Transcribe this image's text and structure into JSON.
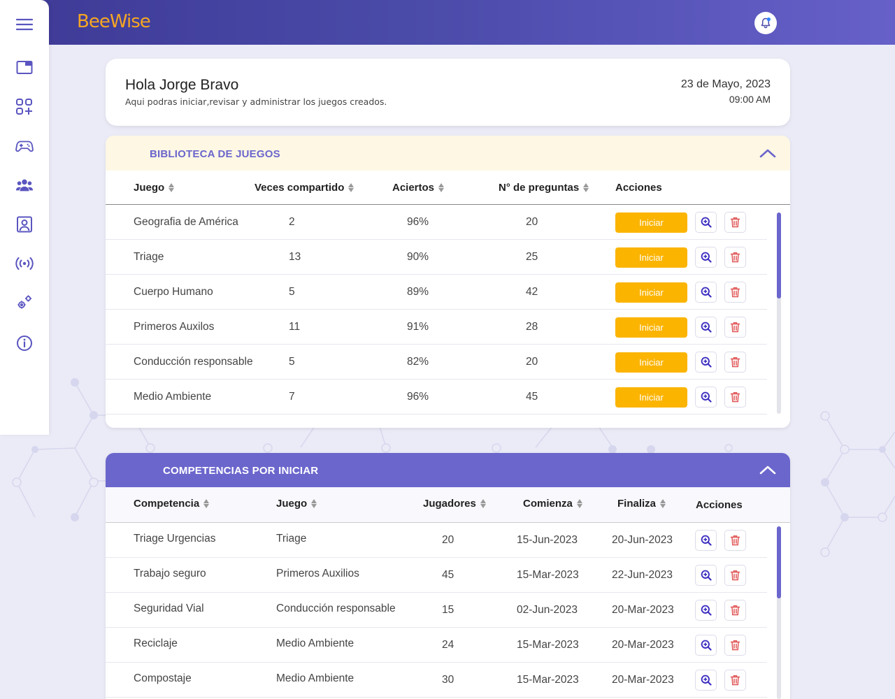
{
  "app": {
    "logo": "BeeWise"
  },
  "sidebar": {
    "items": [
      {
        "name": "menu-icon"
      },
      {
        "name": "window-icon"
      },
      {
        "name": "apps-add-icon"
      },
      {
        "name": "gamepad-icon"
      },
      {
        "name": "users-icon"
      },
      {
        "name": "contact-icon"
      },
      {
        "name": "broadcast-icon"
      },
      {
        "name": "settings-icon"
      },
      {
        "name": "info-icon"
      }
    ]
  },
  "greeting": {
    "title": "Hola Jorge Bravo",
    "subtitle": "Aqui podras iniciar,revisar y administrar los juegos creados.",
    "date": "23 de Mayo, 2023",
    "time": "09:00 AM"
  },
  "library": {
    "title": "BIBLIOTECA DE JUEGOS",
    "columns": [
      "Juego",
      "Veces compartido",
      "Aciertos",
      "N° de preguntas",
      "Acciones"
    ],
    "start_label": "Iniciar",
    "rows": [
      {
        "game": "Geografia de América",
        "shared": "2",
        "hits": "96%",
        "questions": "20"
      },
      {
        "game": "Triage",
        "shared": "13",
        "hits": "90%",
        "questions": "25"
      },
      {
        "game": "Cuerpo Humano",
        "shared": "5",
        "hits": "89%",
        "questions": "42"
      },
      {
        "game": "Primeros Auxilos",
        "shared": "11",
        "hits": "91%",
        "questions": "28"
      },
      {
        "game": "Conducción responsable",
        "shared": "5",
        "hits": "82%",
        "questions": "20"
      },
      {
        "game": "Medio Ambiente",
        "shared": "7",
        "hits": "96%",
        "questions": "45"
      }
    ]
  },
  "competitions": {
    "title": "COMPETENCIAS POR INICIAR",
    "columns": [
      "Competencia",
      "Juego",
      "Jugadores",
      "Comienza",
      "Finaliza",
      "Acciones"
    ],
    "rows": [
      {
        "name": "Triage Urgencias",
        "game": "Triage",
        "players": "20",
        "start": "15-Jun-2023",
        "end": "20-Jun-2023"
      },
      {
        "name": "Trabajo seguro",
        "game": "Primeros Auxilios",
        "players": "45",
        "start": "15-Mar-2023",
        "end": "22-Jun-2023"
      },
      {
        "name": "Seguridad Vial",
        "game": "Conducción responsable",
        "players": "15",
        "start": "02-Jun-2023",
        "end": "20-Mar-2023"
      },
      {
        "name": "Reciclaje",
        "game": "Medio Ambiente",
        "players": "24",
        "start": "15-Mar-2023",
        "end": "20-Mar-2023"
      },
      {
        "name": "Compostaje",
        "game": "Medio Ambiente",
        "players": "30",
        "start": "15-Mar-2023",
        "end": "20-Mar-2023"
      }
    ]
  },
  "colors": {
    "primary": "#6b66cc",
    "accent": "#fbb400",
    "logo": "#f5a623",
    "delete": "#e05555",
    "library_header_bg": "#fdf7e4"
  }
}
